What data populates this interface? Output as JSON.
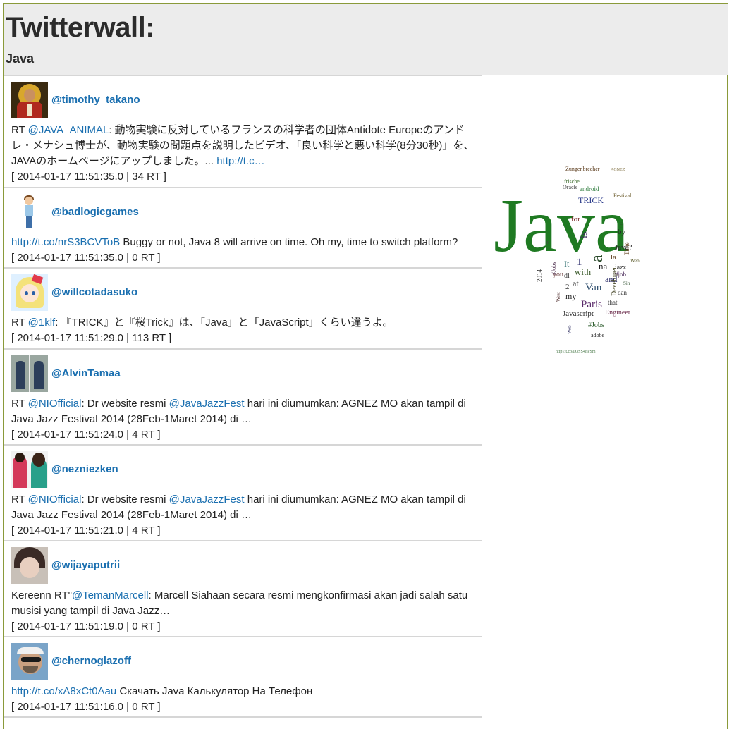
{
  "header": {
    "title": "Twitterwall:",
    "subtitle": "Java"
  },
  "tweets": [
    {
      "user": "@timothy_takano",
      "avatar": "icon-saint",
      "prefix": "RT ",
      "mention": "@JAVA_ANIMAL",
      "body": ": 動物実験に反対しているフランスの科学者の団体Antidote Europeのアンドレ・メナシュ博士が、動物実験の問題点を説明したビデオ、「良い科学と悪い科学(8分30秒)」を、JAVAのホームページにアップしました。... ",
      "link": "http://t.c…",
      "meta": "[ 2014-01-17 11:51:35.0 | 34 RT ]"
    },
    {
      "user": "@badlogicgames",
      "avatar": "pixel-character",
      "link": "http://t.co/nrS3BCVToB",
      "body": " Buggy or not, Java 8 will arrive on time. Oh my, time to switch platform?",
      "meta": "[ 2014-01-17 11:51:35.0 | 0 RT ]"
    },
    {
      "user": "@willcotadasuko",
      "avatar": "anime-girl",
      "prefix": "RT ",
      "mention": "@1klf",
      "body": ": 『TRICK』と『桜Trick』は、「Java」と「JavaScript」くらい違うよ。",
      "meta": "[ 2014-01-17 11:51:29.0 | 113 RT ]"
    },
    {
      "user": "@AlvinTamaa",
      "avatar": "twin-photo",
      "prefix": "RT ",
      "mention": "@NIOfficial",
      "mid": ": Dr website resmi ",
      "mention2": "@JavaJazzFest",
      "body": " hari ini diumumkan: AGNEZ MO akan tampil di Java Jazz Festival 2014 (28Feb-1Maret 2014) di …",
      "meta": "[ 2014-01-17 11:51:24.0 | 4 RT ]"
    },
    {
      "user": "@nezniezken",
      "avatar": "couple-photo",
      "prefix": "RT ",
      "mention": "@NIOfficial",
      "mid": ": Dr website resmi ",
      "mention2": "@JavaJazzFest",
      "body": " hari ini diumumkan: AGNEZ MO akan tampil di Java Jazz Festival 2014 (28Feb-1Maret 2014) di …",
      "meta": "[ 2014-01-17 11:51:21.0 | 4 RT ]"
    },
    {
      "user": "@wijayaputrii",
      "avatar": "selfie-photo",
      "prefix": "Kereenn RT\"",
      "mention": "@TemanMarcell",
      "body": ": Marcell Siahaan secara resmi mengkonfirmasi akan jadi salah satu musisi yang tampil di Java Jazz…",
      "meta": "[ 2014-01-17 11:51:19.0 | 0 RT ]"
    },
    {
      "user": "@chernoglazoff",
      "avatar": "man-sunglasses",
      "link": "http://t.co/xA8xCt0Aau",
      "body": " Скачать Java Калькулятор На Телефон",
      "meta": "[ 2014-01-17 11:51:16.0 | 0 RT ]"
    }
  ],
  "wordcloud": {
    "main_word": "Java",
    "words": [
      "Zungenbrecher",
      "AGNEZ",
      "android",
      "Oracle",
      "frische",
      "TRICK",
      "Festival",
      "for",
      "by",
      "is",
      "a",
      "la",
      "on",
      "Time",
      "1",
      "na",
      "jazz",
      "It",
      "with",
      "and",
      "#job",
      "Van",
      "at",
      "2",
      "my",
      "2014",
      "you",
      "Developer",
      "Javascript",
      "Engineer",
      "Paris",
      "#Jobs",
      "di",
      "that",
      "dan",
      "adobe",
      "West",
      "Sin",
      "m",
      "Java?",
      "Web"
    ],
    "url_text": "http://t.co/D3SS4FPSm"
  },
  "colors": {
    "link": "#1a6fb0",
    "header_bg": "#ececec",
    "java_green": "#1f7a22"
  }
}
